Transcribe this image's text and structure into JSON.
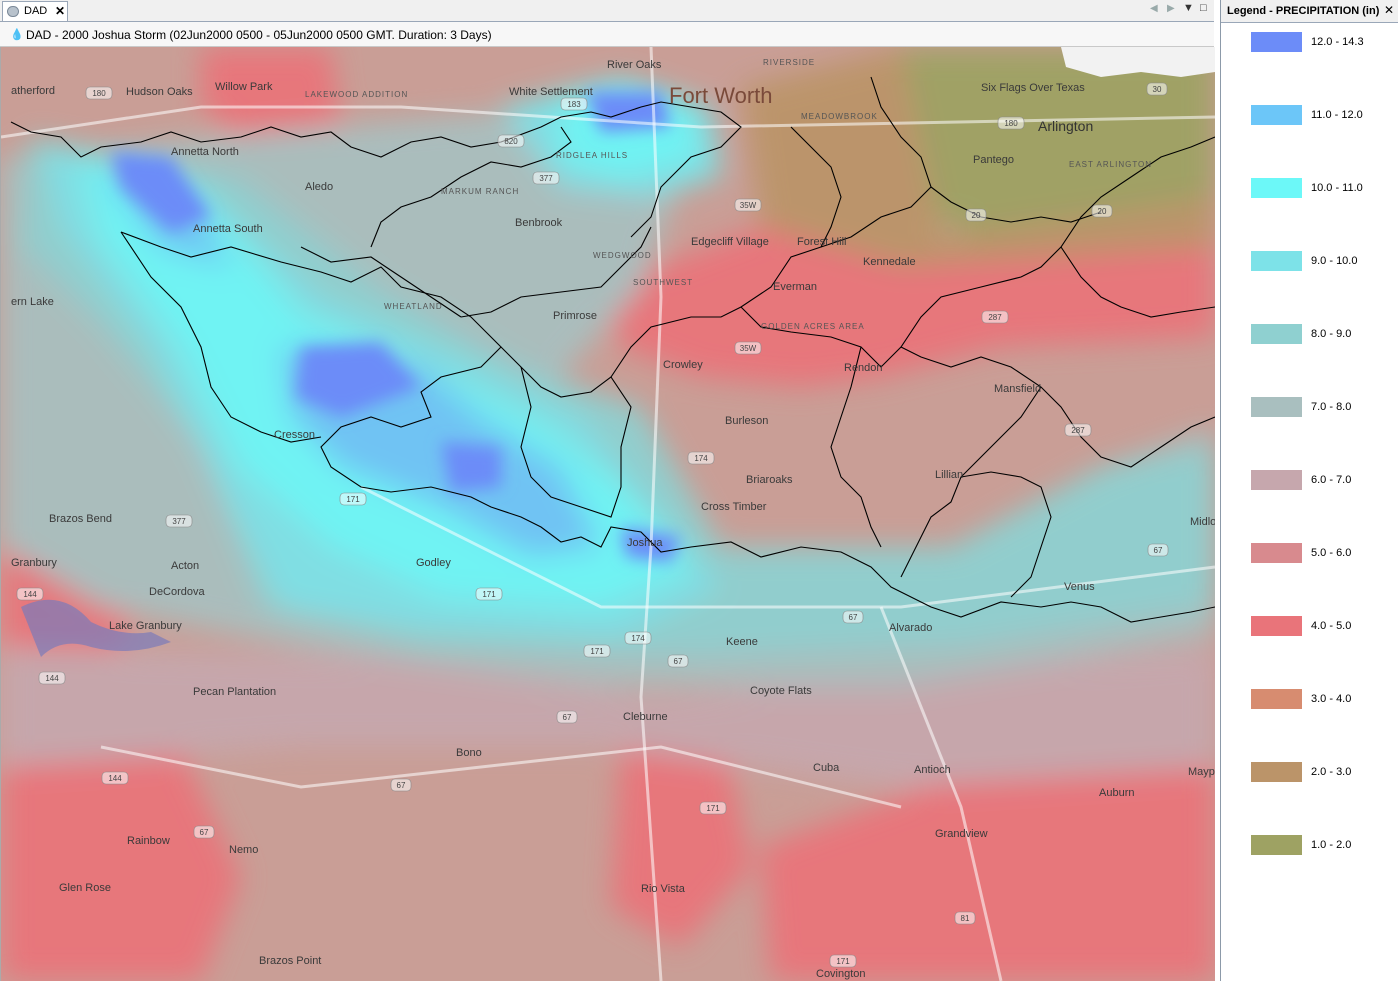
{
  "tab": {
    "label": "DAD",
    "close": "✕"
  },
  "window_title": "DAD - 2000 Joshua Storm (02Jun2000 0500 - 05Jun2000 0500 GMT.  Duration: 3 Days)",
  "legend": {
    "title": "Legend - PRECIPITATION (in)",
    "close": "✕",
    "items": [
      {
        "label": "12.0 - 14.3",
        "color": "#6c8cf8"
      },
      {
        "label": "11.0 - 12.0",
        "color": "#6cc6f8"
      },
      {
        "label": "10.0 - 11.0",
        "color": "#6cf8f8"
      },
      {
        "label": "9.0 - 10.0",
        "color": "#7de2e8"
      },
      {
        "label": "8.0 - 9.0",
        "color": "#8fd0d0"
      },
      {
        "label": "7.0 - 8.0",
        "color": "#a9bfbf"
      },
      {
        "label": "6.0 - 7.0",
        "color": "#c6a7ad"
      },
      {
        "label": "5.0 - 6.0",
        "color": "#d88a8e"
      },
      {
        "label": "4.0 - 5.0",
        "color": "#e9747a"
      },
      {
        "label": "3.0 - 4.0",
        "color": "#d78c70"
      },
      {
        "label": "2.0 - 3.0",
        "color": "#bb9469"
      },
      {
        "label": "1.0 - 2.0",
        "color": "#9ea263"
      }
    ]
  },
  "map": {
    "places": [
      {
        "name": "Fort Worth",
        "size": "big"
      },
      {
        "name": "Arlington",
        "size": "med"
      },
      {
        "name": "Six Flags Over Texas",
        "size": "small"
      },
      {
        "name": "Pantego",
        "size": "small"
      },
      {
        "name": "River Oaks",
        "size": "small"
      },
      {
        "name": "White Settlement",
        "size": "small"
      },
      {
        "name": "Hudson Oaks",
        "size": "small"
      },
      {
        "name": "Willow Park",
        "size": "small"
      },
      {
        "name": "atherford",
        "size": "small"
      },
      {
        "name": "Annetta North",
        "size": "small"
      },
      {
        "name": "Annetta South",
        "size": "small"
      },
      {
        "name": "Aledo",
        "size": "small"
      },
      {
        "name": "Benbrook",
        "size": "small"
      },
      {
        "name": "Edgecliff Village",
        "size": "small"
      },
      {
        "name": "Forest Hill",
        "size": "small"
      },
      {
        "name": "Kennedale",
        "size": "small"
      },
      {
        "name": "Everman",
        "size": "small"
      },
      {
        "name": "Primrose",
        "size": "small"
      },
      {
        "name": "Crowley",
        "size": "small"
      },
      {
        "name": "Rendon",
        "size": "small"
      },
      {
        "name": "Mansfield",
        "size": "small"
      },
      {
        "name": "Burleson",
        "size": "small"
      },
      {
        "name": "Briaroaks",
        "size": "small"
      },
      {
        "name": "Cross Timber",
        "size": "small"
      },
      {
        "name": "Cresson",
        "size": "small"
      },
      {
        "name": "Lillian",
        "size": "small"
      },
      {
        "name": "Joshua",
        "size": "small"
      },
      {
        "name": "Godley",
        "size": "small"
      },
      {
        "name": "Venus",
        "size": "small"
      },
      {
        "name": "Midlo",
        "size": "small"
      },
      {
        "name": "Brazos Bend",
        "size": "small"
      },
      {
        "name": "Granbury",
        "size": "small"
      },
      {
        "name": "Acton",
        "size": "small"
      },
      {
        "name": "DeCordova",
        "size": "small"
      },
      {
        "name": "Lake Granbury",
        "size": "small"
      },
      {
        "name": "Keene",
        "size": "small"
      },
      {
        "name": "Alvarado",
        "size": "small"
      },
      {
        "name": "Coyote Flats",
        "size": "small"
      },
      {
        "name": "Pecan Plantation",
        "size": "small"
      },
      {
        "name": "Cleburne",
        "size": "small"
      },
      {
        "name": "Bono",
        "size": "small"
      },
      {
        "name": "Cuba",
        "size": "small"
      },
      {
        "name": "Antioch",
        "size": "small"
      },
      {
        "name": "Mayp",
        "size": "small"
      },
      {
        "name": "Auburn",
        "size": "small"
      },
      {
        "name": "Grandview",
        "size": "small"
      },
      {
        "name": "Rainbow",
        "size": "small"
      },
      {
        "name": "Nemo",
        "size": "small"
      },
      {
        "name": "Glen Rose",
        "size": "small"
      },
      {
        "name": "Rio Vista",
        "size": "small"
      },
      {
        "name": "Brazos Point",
        "size": "small"
      },
      {
        "name": "Covington",
        "size": "small"
      },
      {
        "name": "ern Lake",
        "size": "small"
      },
      {
        "name": "WHEATLAND",
        "size": "tiny"
      },
      {
        "name": "MARKUM RANCH",
        "size": "tiny"
      },
      {
        "name": "RIDGLEA HILLS",
        "size": "tiny"
      },
      {
        "name": "WEDGWOOD",
        "size": "tiny"
      },
      {
        "name": "SOUTHWEST",
        "size": "tiny"
      },
      {
        "name": "GOLDEN ACRES AREA",
        "size": "tiny"
      },
      {
        "name": "MEADOWBROOK",
        "size": "tiny"
      },
      {
        "name": "EAST ARLINGTON",
        "size": "tiny"
      },
      {
        "name": "LAKEWOOD ADDITION",
        "size": "tiny"
      },
      {
        "name": "RIVERSIDE",
        "size": "tiny"
      }
    ],
    "highways": [
      "180",
      "20",
      "30",
      "183",
      "820",
      "377",
      "35W",
      "287",
      "174",
      "171",
      "67",
      "144",
      "81"
    ]
  }
}
